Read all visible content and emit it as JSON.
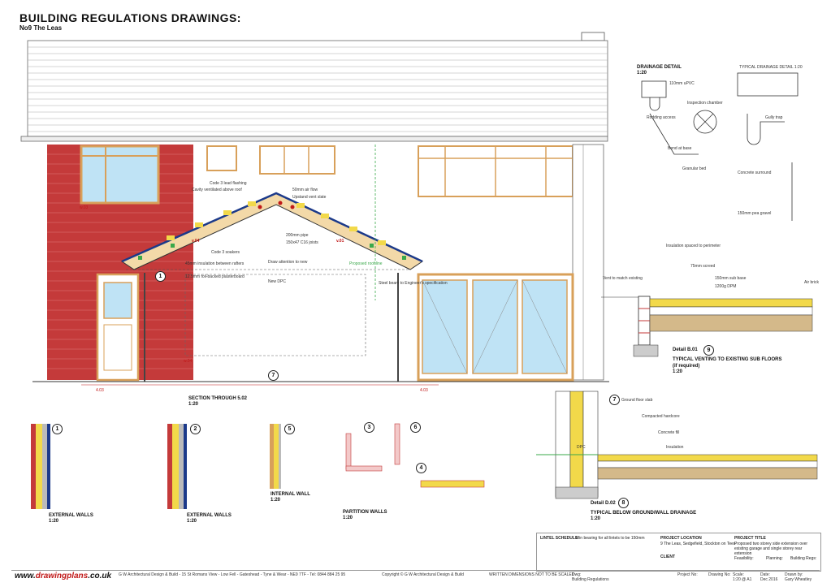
{
  "drawing": {
    "title": "BUILDING REGULATIONS DRAWINGS:",
    "subtitle": "No9 The Leas"
  },
  "elevation": {
    "wall_tag_left": "w.03",
    "wall_tag_right": "w.04",
    "vent_tag_left": "v.04",
    "vent_tag_right": "v.01",
    "dim_left": "4.03",
    "dim_right": "4.03",
    "section_badge": "7",
    "roof_badge": "1",
    "notes": [
      "Code 3 lead flashing",
      "Cavity ventilated above roof",
      "50mm air flow",
      "Upstand vent slate",
      "200mm pipe",
      "150x47 C16 joists",
      "Code 3 soakers",
      "Draw attention to new",
      "45mm insulation between rafters",
      "12.5mm foil-backed plasterboard",
      "Proposed roof line",
      "New DPC",
      "Steel beam to Engineer's specification"
    ]
  },
  "section_title": {
    "label": "SECTION THROUGH 5.02",
    "scale": "1:20"
  },
  "drainage": {
    "title": "DRAINAGE DETAIL",
    "scale": "1:20",
    "typical_label": "TYPICAL DRAINAGE DETAIL 1:20",
    "notes": [
      "110mm uPVC",
      "Rodding access",
      "Inspection chamber",
      "Bend at base",
      "Gully trap",
      "Granular bed",
      "Concrete surround",
      "150mm pea gravel"
    ]
  },
  "detail_b01": {
    "label": "Detail B.01",
    "badge": "9",
    "title_line1": "TYPICAL VENTING TO EXISTING SUB FLOORS",
    "title_line2": "(if required)",
    "scale": "1:20",
    "notes": [
      "Insulation spaced to perimeter",
      "75mm screed",
      "Vent to match existing",
      "150mm sub base",
      "1200g DPM",
      "Air brick"
    ]
  },
  "detail_d02": {
    "label": "Detail D.02",
    "badge": "8",
    "badge_top": "7",
    "title": "TYPICAL BELOW GROUND/WALL DRAINAGE",
    "scale": "1:20",
    "notes": [
      "Ground floor slab",
      "Compacted hardcore",
      "Concrete fill",
      "DPC",
      "Insulation"
    ]
  },
  "wall_details": [
    {
      "badge": "1",
      "title": "EXTERNAL WALLS",
      "scale": "1:20"
    },
    {
      "badge": "2",
      "title": "EXTERNAL WALLS",
      "scale": "1:20"
    },
    {
      "badge": "5",
      "title": "INTERNAL WALL",
      "scale": "1:20"
    },
    {
      "badge": "3",
      "title": "PARTITION WALLS",
      "scale": "1:20"
    },
    {
      "badge": "6",
      "title": "",
      "scale": ""
    },
    {
      "badge": "4",
      "title": "",
      "scale": ""
    }
  ],
  "lintel_schedule": {
    "title": "LINTEL SCHEDULE",
    "note": "Min bearing for all lintels to be 150mm"
  },
  "title_block": {
    "project_location_label": "PROJECT LOCATION",
    "project_location": "9 The Leas, Sedgefield, Stockton on Tees",
    "client_label": "CLIENT",
    "project_title_label": "PROJECT TITLE",
    "project_title": "Proposed two storey side extension over existing garage and single storey rear extension",
    "feasibility": "Feasibility:",
    "planning": "Planning:",
    "building_regs": "Building Regs:",
    "project_no_label": "Project No:",
    "drawing_no_label": "Drawing No:",
    "scale_label": "Scale:",
    "scale": "1:20 @ A1",
    "date_label": "Date:",
    "date": "Dec 2016",
    "drawn_label": "Drawn by:",
    "drawn": "Gary Wheatley",
    "dwg_label": "Dwg:",
    "dwg": "Building Regulations"
  },
  "footer": {
    "logo_plain": "www.",
    "logo_bold": "drawingplans",
    "logo_tail": ".co.uk",
    "company": "G W Architectural Design & Build - 15 St Romans View - Low Fell - Gateshead - Tyne & Wear - NE9 7TF - Tel: 0844 884 25 95",
    "copyright": "Copyright © G W Architectural Design & Build",
    "warning": "WRITTEN DIMENSIONS NOT TO BE SCALED"
  },
  "colors": {
    "brick": "#c43a3a",
    "window": "#d8a05a",
    "glass": "#bfe3f5",
    "insulation": "#f2d94a",
    "accent_red": "#c01818"
  }
}
